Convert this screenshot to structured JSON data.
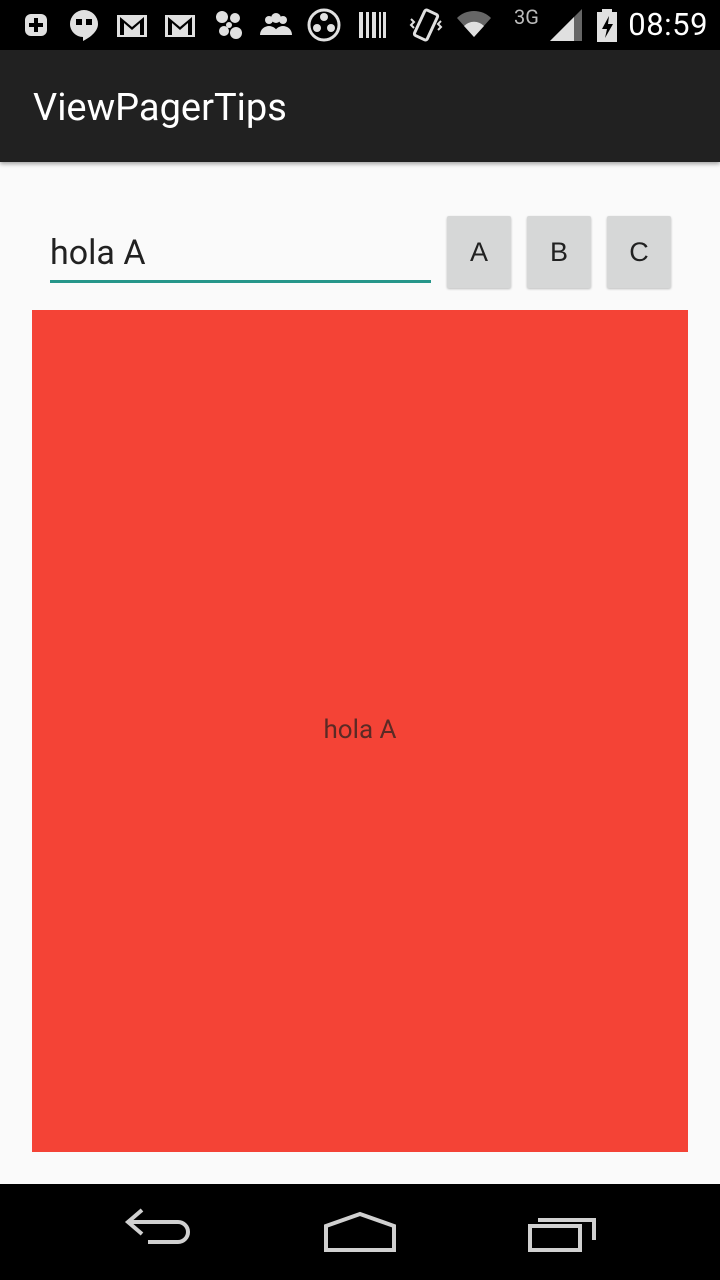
{
  "status_bar": {
    "time": "08:59",
    "network": "3G",
    "icons": [
      "add-icon",
      "hangouts-icon",
      "gmail-icon",
      "gmail-icon",
      "pinwheel-icon",
      "people-icon",
      "reel-icon",
      "barcode-icon",
      "vibrate-icon",
      "wifi-icon",
      "signal-icon",
      "battery-icon"
    ]
  },
  "app_bar": {
    "title": "ViewPagerTips"
  },
  "editor": {
    "value": "hola A"
  },
  "tabs": [
    {
      "label": "A"
    },
    {
      "label": "B"
    },
    {
      "label": "C"
    }
  ],
  "page": {
    "text": "hola A",
    "color": "#f44336"
  },
  "colors": {
    "accent": "#26968a",
    "toolbar": "#212121"
  }
}
